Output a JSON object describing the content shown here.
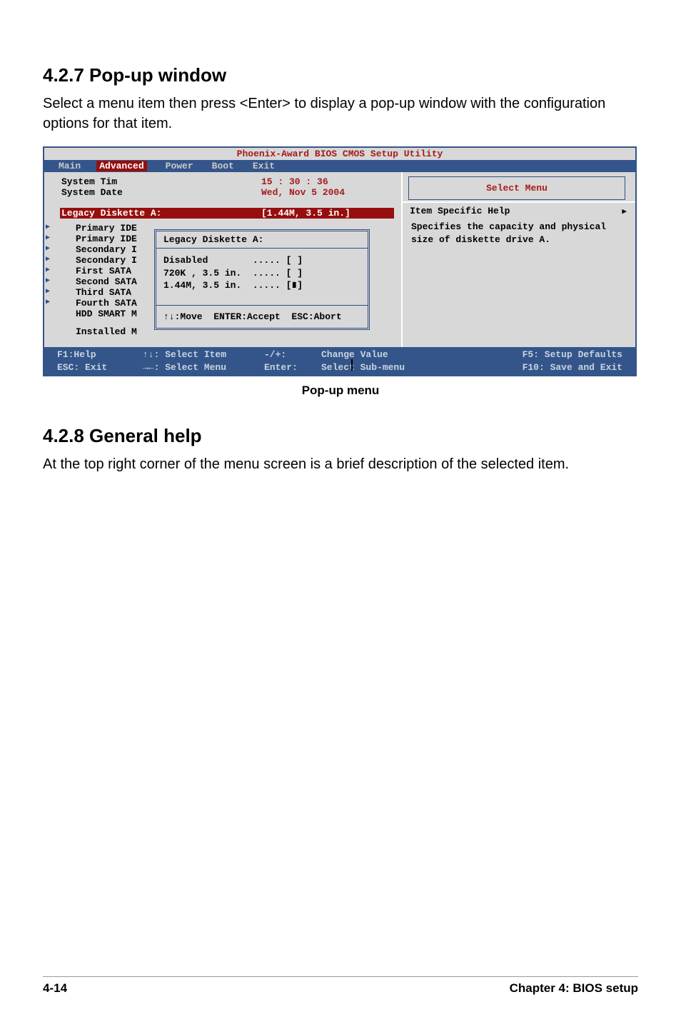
{
  "section427": {
    "heading": "4.2.7   Pop-up window",
    "text": "Select a menu item then press <Enter> to display a pop-up window with the configuration options for that item."
  },
  "bios": {
    "title": "Phoenix-Award BIOS CMOS Setup Utility",
    "menu": {
      "main": "Main",
      "advanced": "Advanced",
      "power": "Power",
      "boot": "Boot",
      "exit": "Exit"
    },
    "left": {
      "system_tim_label": "System Tim",
      "system_tim_value": "15 : 30 : 36",
      "system_date_label": "System Date",
      "system_date_value": "Wed, Nov 5 2004",
      "legacy_a_label": "Legacy Diskette A:",
      "legacy_a_value": "[1.44M, 3.5 in.]",
      "submenu": [
        "Primary IDE",
        "Primary IDE",
        "Secondary I",
        "Secondary I",
        "First SATA",
        "Second SATA",
        "Third SATA",
        "Fourth SATA"
      ],
      "hdd_smart": "HDD SMART M",
      "installed": "Installed M"
    },
    "popup": {
      "title": "Legacy Diskette A:",
      "opt1": "Disabled        ..... [ ]",
      "opt2": "720K , 3.5 in.  ..... [ ]",
      "opt3": "1.44M, 3.5 in.  ..... [∎]",
      "footer": "↑↓:Move  ENTER:Accept  ESC:Abort"
    },
    "right": {
      "select_menu": "Select Menu",
      "item_help": "Item Specific Help",
      "help_text": "Specifies the capacity and physical size of diskette drive A."
    },
    "footer": {
      "f1": "F1:Help",
      "select_item": "↑↓: Select Item",
      "change_key": "-/+:",
      "change_value": "Change Value",
      "f5": "F5: Setup Defaults",
      "esc": "ESC: Exit",
      "select_menu": "→←: Select Menu",
      "enter_key": "Enter:",
      "select_submenu": "Select Sub-menu",
      "f10": "F10: Save and Exit"
    }
  },
  "caption": "Pop-up menu",
  "section428": {
    "heading": "4.2.8   General help",
    "text": "At the top right corner of the menu screen is a brief description of the selected item."
  },
  "footer": {
    "page": "4-14",
    "chapter": "Chapter 4: BIOS setup"
  }
}
